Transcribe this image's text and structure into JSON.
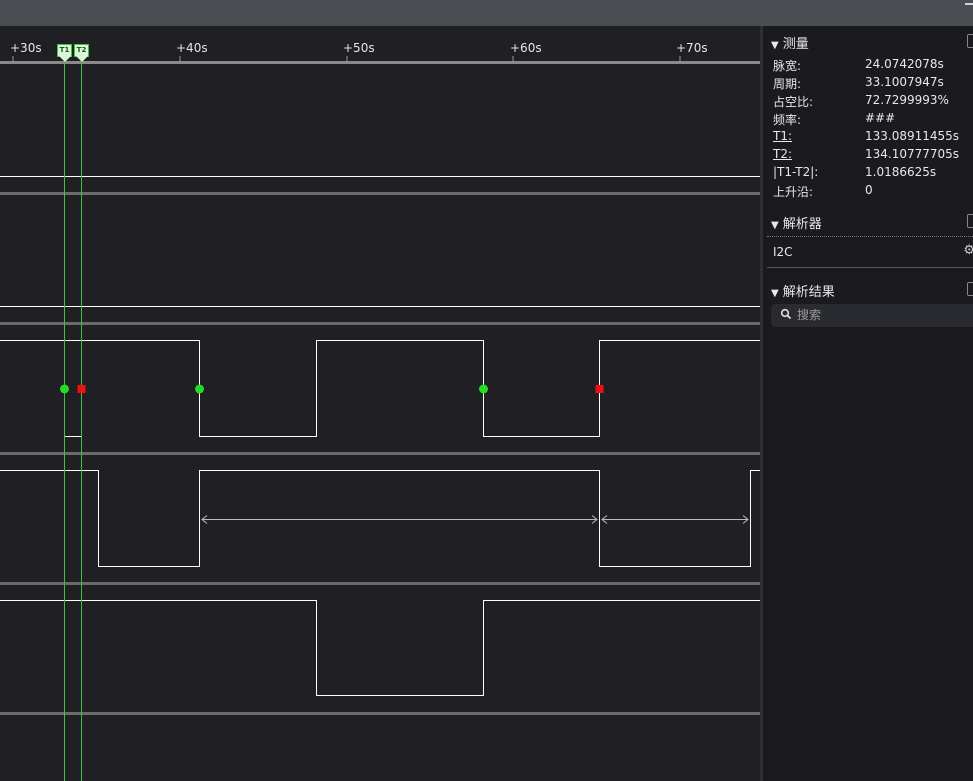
{
  "timeline": {
    "ticks": [
      "+30s",
      "+40s",
      "+50s",
      "+60s",
      "+70s"
    ],
    "cursor_labels": [
      "T1",
      "T2"
    ]
  },
  "measurements": {
    "title": "测量",
    "rows": [
      {
        "label": "脉宽:",
        "value": "24.0742078s"
      },
      {
        "label": "周期:",
        "value": "33.1007947s"
      },
      {
        "label": "占空比:",
        "value": "72.7299993%"
      },
      {
        "label": "频率:",
        "value": "###"
      },
      {
        "label": "T1:",
        "value": "133.08911455s"
      },
      {
        "label": "T2:",
        "value": "134.10777705s"
      },
      {
        "label": "|T1-T2|:",
        "value": "1.0186625s"
      },
      {
        "label": "上升沿:",
        "value": "0"
      }
    ]
  },
  "decoder": {
    "title": "解析器",
    "name": "I2C"
  },
  "results": {
    "title": "解析结果",
    "search_placeholder": "搜索"
  },
  "colors": {
    "background": "#1f1f24",
    "trace": "#ffffff",
    "cursor": "#3ec23e",
    "rising_marker": "#22dd22",
    "falling_marker": "#ee1111"
  }
}
